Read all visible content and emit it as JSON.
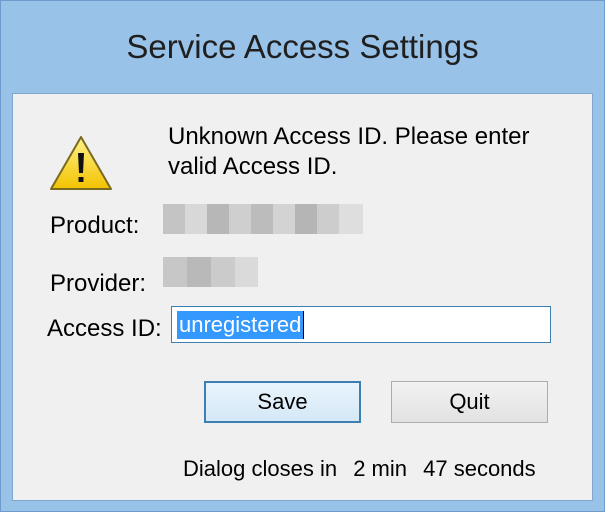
{
  "window": {
    "title": "Service Access Settings"
  },
  "message": {
    "line1": "Unknown Access ID. Please enter",
    "line2": "valid Access ID."
  },
  "fields": {
    "product_label": "Product:",
    "provider_label": "Provider:",
    "access_id_label": "Access ID:",
    "access_id_value": "unregistered"
  },
  "buttons": {
    "save": "Save",
    "quit": "Quit"
  },
  "countdown": {
    "prefix": "Dialog closes in",
    "minutes": "2 min",
    "seconds": "47 seconds"
  },
  "icons": {
    "message": "warning-icon"
  },
  "colors": {
    "title_bar": "#99c2e9",
    "focus_border": "#3c7fb1",
    "selection": "#3399ff"
  }
}
